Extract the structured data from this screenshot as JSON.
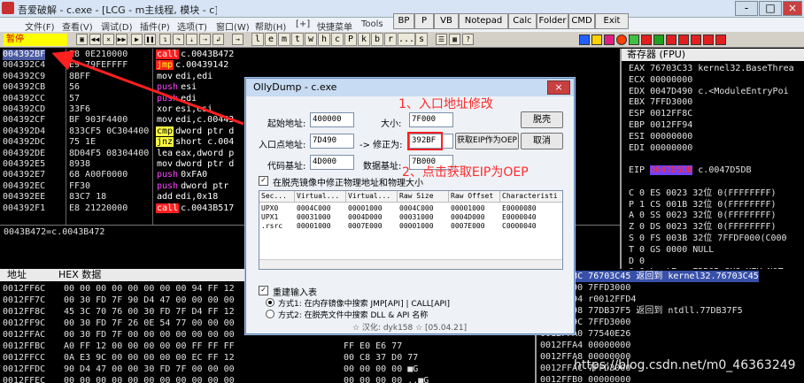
{
  "window": {
    "title": "吾爱破解 - c.exe - [LCG - m主线程, 模块 - c]",
    "min": "-",
    "max": "□",
    "close": "×"
  },
  "plugins": [
    "BP",
    "P",
    "VB",
    "Notepad",
    "Calc",
    "Folder",
    "CMD",
    "Exit"
  ],
  "menu": [
    "文件(F)",
    "查看(V)",
    "调试(D)",
    "插件(P)",
    "选项(T)",
    "窗口(W)",
    "帮助(H)",
    "[+]",
    "快捷菜单",
    "Tools"
  ],
  "toolbar": {
    "status": "暂停",
    "letters": [
      "l",
      "e",
      "m",
      "t",
      "w",
      "h",
      "c",
      "P",
      "k",
      "b",
      "r",
      "...",
      "s"
    ]
  },
  "cpu": {
    "rows": [
      {
        "addr": "004392BF",
        "hex": "E8 0E210000",
        "mn": "call",
        "op": "c.0043B472",
        "cls": "hlcall",
        "sel": true
      },
      {
        "addr": "004392C4",
        "hex": "E9 79FEFFFF",
        "mn": "jmp",
        "op": "c.00439142",
        "cls": "hljmp"
      },
      {
        "addr": "004392C9",
        "hex": "8BFF",
        "mn": "mov",
        "op": "edi,edi",
        "cls": "hlmov"
      },
      {
        "addr": "004392CB",
        "hex": "56",
        "mn": "push",
        "op": "esi",
        "cls": "hlpush"
      },
      {
        "addr": "004392CC",
        "hex": "57",
        "mn": "push",
        "op": "edi",
        "cls": "hlpush"
      },
      {
        "addr": "004392CD",
        "hex": "33F6",
        "mn": "xor",
        "op": "esi,esi",
        "cls": "hlxor"
      },
      {
        "addr": "004392CF",
        "hex": "BF 903F4400",
        "mn": "mov",
        "op": "edi,c.00443",
        "cls": "hlmov"
      },
      {
        "addr": "004392D4",
        "hex": "833CF5 0C304400",
        "mn": "cmp",
        "op": "dword ptr d",
        "cls": "hlcmp"
      },
      {
        "addr": "004392DC",
        "hex": "75 1E",
        "mn": "jnz",
        "op": "short c.004",
        "cls": "hljnz"
      },
      {
        "addr": "004392DE",
        "hex": "8D04F5 08304400",
        "mn": "lea",
        "op": "eax,dword p",
        "cls": "hllea"
      },
      {
        "addr": "004392E5",
        "hex": "8938",
        "mn": "mov",
        "op": "dword ptr d",
        "cls": "hlmov"
      },
      {
        "addr": "004392E7",
        "hex": "68 A00F0000",
        "mn": "push",
        "op": "0xFA0",
        "cls": "hlpush"
      },
      {
        "addr": "004392EC",
        "hex": "FF30",
        "mn": "push",
        "op": "dword ptr",
        "cls": "hlpush"
      },
      {
        "addr": "004392EE",
        "hex": "83C7 18",
        "mn": "add",
        "op": "edi,0x18",
        "cls": "hladd"
      },
      {
        "addr": "004392F1",
        "hex": "E8 21220000",
        "mn": "call",
        "op": "c.0043B517",
        "cls": "hlcall"
      }
    ],
    "info": "0043B472=c.0043B472"
  },
  "dump": {
    "hdr_addr": "地址",
    "hdr_hex": "HEX 数据",
    "rows": [
      {
        "a": "0012FF6C",
        "h": "00 00 00 00 00 00 00 00 94 FF 12",
        "t": ""
      },
      {
        "a": "0012FF7C",
        "h": "00 30 FD 7F 90 D4 47 00 00 00 00",
        "t": ""
      },
      {
        "a": "0012FF8C",
        "h": "45 3C 70 76 00 30 FD 7F D4 FF 12",
        "t": ""
      },
      {
        "a": "0012FF9C",
        "h": "00 30 FD 7F 26 0E 54 77 00 00 00",
        "t": ""
      },
      {
        "a": "0012FFAC",
        "h": "00 30 FD 7F 00 00 00 00 00 00 00",
        "t": ""
      },
      {
        "a": "0012FFBC",
        "h": "A0 FF 12 00 00 00 00 00 FF FF FF",
        "t": "FF E0 E6 77"
      },
      {
        "a": "0012FFCC",
        "h": "0A E3 9C 00 00 00 00 00 EC FF 12",
        "t": "00 C8 37 D0 77"
      },
      {
        "a": "0012FFDC",
        "h": "90 D4 47 00 00 30 FD 7F 00 00 00",
        "t": "00 00 00 00 ■G"
      },
      {
        "a": "0012FFEC",
        "h": "00 00 00 00 00 00 00 00 00 00 00",
        "t": "00 00 00 00 ..■G"
      }
    ]
  },
  "regs": {
    "hdr": "寄存器 (FPU)",
    "rows": [
      {
        "t": "EAX 76703C33 kernel32.BaseThrea"
      },
      {
        "t": "ECX 00000000"
      },
      {
        "t": "EDX 0047D490 c.<ModuleEntryPoi"
      },
      {
        "t": "EBX 7FFD3000"
      },
      {
        "t": "ESP 0012FF8C",
        "red": true
      },
      {
        "t": "EBP 0012FF94"
      },
      {
        "t": "ESI 00000000"
      },
      {
        "t": "EDI 00000000"
      },
      {
        "t": ""
      },
      {
        "t": "EIP 0047D5DB c.0047D5DB",
        "eip": true
      },
      {
        "t": ""
      },
      {
        "t": "C 0   ES 0023 32位 0(FFFFFFFF)"
      },
      {
        "t": "P 1   CS 001B 32位 0(FFFFFFFF)"
      },
      {
        "t": "A 0   SS 0023 32位 0(FFFFFFFF)"
      },
      {
        "t": "Z 0   DS 0023 32位 0(FFFFFFFF)"
      },
      {
        "t": "S 0   FS 003B 32位 7FFDF000(C000"
      },
      {
        "t": "T 0   GS 0000 NULL"
      },
      {
        "t": "D 0"
      },
      {
        "t": "O 0   LastErr ERROR_SXS_KEY_NOT_"
      }
    ]
  },
  "stack": {
    "rows": [
      {
        "t": "0012FF8C  76703C45  返回到 kernel32.76703C45",
        "sel": true
      },
      {
        "t": "0012FF90  7FFD3000"
      },
      {
        "t": "0012FF94  r0012FFD4"
      },
      {
        "t": "0012FF98  77DB37F5  返回到 ntdll.77DB37F5"
      },
      {
        "t": "0012FF9C  7FFD3000"
      },
      {
        "t": "0012FFA0  77540E26"
      },
      {
        "t": "0012FFA4  00000000"
      },
      {
        "t": "0012FFA8  00000000"
      },
      {
        "t": "0012FFAC  7FFD3000"
      },
      {
        "t": "0012FFB0  00000000"
      }
    ]
  },
  "dialog": {
    "title": "OllyDump - c.exe",
    "start_label": "起始地址:",
    "start_val": "400000",
    "size_label": "大小:",
    "size_val": "7F000",
    "ep_label": "入口点地址:",
    "ep_val": "7D490",
    "fix_label": "-> 修正为:",
    "fix_val": "392BF",
    "code_label": "代码基址:",
    "code_val": "4D000",
    "data_label": "数据基址:",
    "data_val": "7B000",
    "btn_dump": "脱壳",
    "btn_geteip": "获取EIP作为OEP",
    "btn_cancel": "取消",
    "chk_fix": "在脱壳镜像中修正物理地址和物理大小",
    "cols": [
      "Sec...",
      "Virtual...",
      "Virtual...",
      "Raw Size",
      "Raw Offset",
      "Characteristi"
    ],
    "rows": [
      [
        "UPX0",
        "0004C000",
        "00001000",
        "0004C000",
        "00001000",
        "E0000080"
      ],
      [
        "UPX1",
        "00031000",
        "0004D000",
        "00031000",
        "0004D000",
        "E0000040"
      ],
      [
        ".rsrc",
        "00001000",
        "0007E000",
        "00001000",
        "0007E000",
        "C0000040"
      ]
    ],
    "chk_rebuild": "重建输入表",
    "opt1": "方式1: 在内存镜像中搜索 JMP[API] | CALL[API]",
    "opt2": "方式2: 在脱壳文件中搜索 DLL & API 名称",
    "credit": "☆ 汉化: dyk158 ☆ [05.04.21]"
  },
  "annotations": {
    "step1": "1、入口地址修改",
    "step2": "2、点击获取EIP为OEP"
  },
  "watermark": "https://blog.csdn.net/m0_46363249",
  "colors": {
    "accent_red": "#ff2a2a",
    "selection": "#4a5aa0",
    "eip_bg": "#7040ff"
  }
}
